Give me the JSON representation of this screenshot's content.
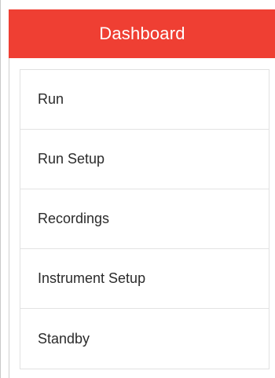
{
  "header": {
    "title": "Dashboard"
  },
  "colors": {
    "header_background": "#ef3f33",
    "header_text": "#ffffff",
    "menu_text": "#2b2b2b"
  },
  "menu": {
    "items": [
      {
        "label": "Run"
      },
      {
        "label": "Run Setup"
      },
      {
        "label": "Recordings"
      },
      {
        "label": "Instrument Setup"
      },
      {
        "label": "Standby"
      }
    ]
  }
}
